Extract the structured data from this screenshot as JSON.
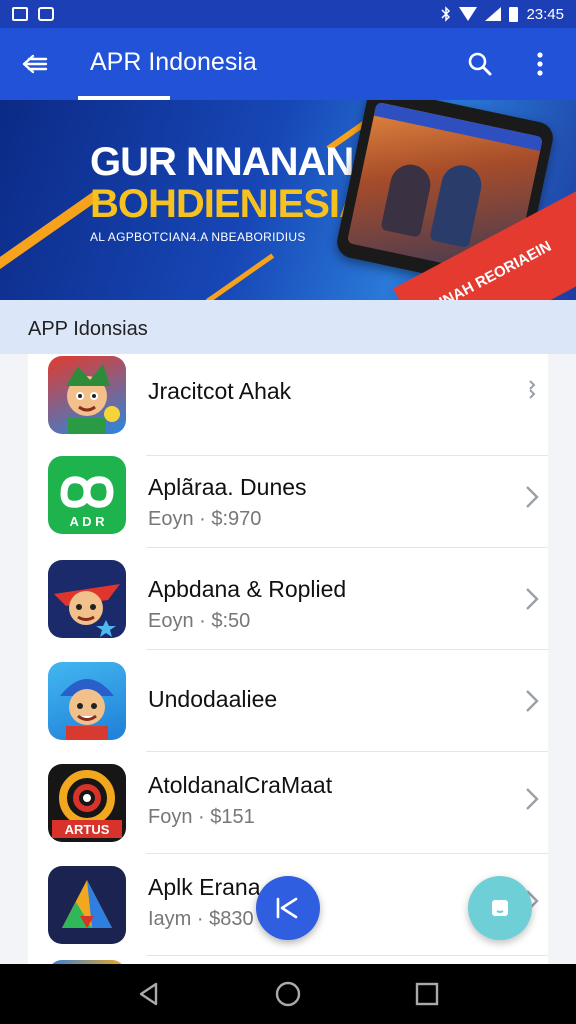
{
  "status_bar": {
    "time": "23:45"
  },
  "app_bar": {
    "title": "APR Indonesia"
  },
  "banner": {
    "line1": "GUR NNANAN",
    "line2": "BOHDIENIESIA",
    "subtitle": "AL AGPBOTCIAN4.A NBEABORIDIUS",
    "ribbon_text": "PASINAH REORIAEIN",
    "accent_colors": {
      "orange": "#f7a21c",
      "red": "#e43a2f",
      "yellow": "#f8c21e"
    }
  },
  "section": {
    "title": "APP Idonsias"
  },
  "apps": [
    {
      "title": "Jracitcot Ahak",
      "subtitle": "",
      "icon": "cartoon-hero-icon"
    },
    {
      "title": "Aplãraa. Dunes",
      "subtitle": "Eoyn · $:970",
      "icon": "green-logo-icon"
    },
    {
      "title": "Apbdana & Roplied",
      "subtitle": "Eoyn · $:50",
      "icon": "pirate-hero-icon"
    },
    {
      "title": "Undodaaliee",
      "subtitle": "",
      "icon": "blue-hat-character-icon"
    },
    {
      "title": "AtoldanalCraMaat",
      "subtitle": "Foyn · $151",
      "icon": "target-logo-icon"
    },
    {
      "title": "Aplk Erana",
      "subtitle": "Iaym · $830",
      "icon": "triangle-logo-icon"
    }
  ],
  "fab": {
    "primary_icon": "back-arrow-icon",
    "secondary_icon": "square-icon",
    "primary_color": "#2f5fe0",
    "secondary_color": "#6fcfd6"
  },
  "nav": {
    "back_icon": "triangle-back-icon",
    "home_icon": "circle-home-icon",
    "recents_icon": "square-recents-icon"
  }
}
